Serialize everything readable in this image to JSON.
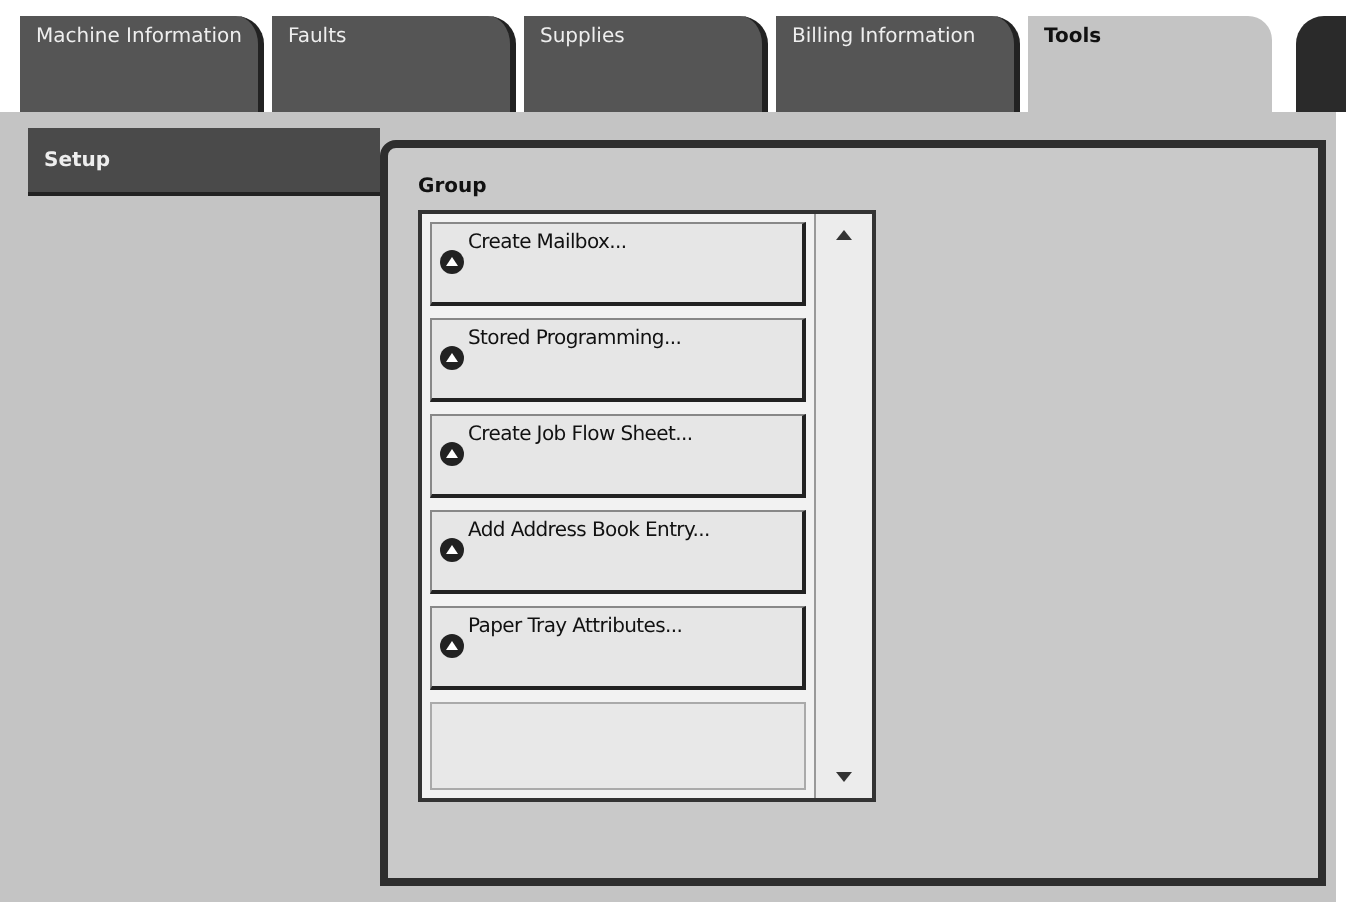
{
  "tabs": [
    {
      "label": "Machine Information",
      "selected": false
    },
    {
      "label": "Faults",
      "selected": false
    },
    {
      "label": "Supplies",
      "selected": false
    },
    {
      "label": "Billing Information",
      "selected": false
    },
    {
      "label": "Tools",
      "selected": true
    }
  ],
  "sidebar": {
    "items": [
      {
        "label": "Setup",
        "selected": true
      }
    ]
  },
  "group": {
    "title": "Group",
    "items": [
      {
        "label": "Create Mailbox..."
      },
      {
        "label": "Stored Programming..."
      },
      {
        "label": "Create Job Flow Sheet..."
      },
      {
        "label": "Add Address Book Entry..."
      },
      {
        "label": "Paper Tray Attributes..."
      }
    ]
  }
}
